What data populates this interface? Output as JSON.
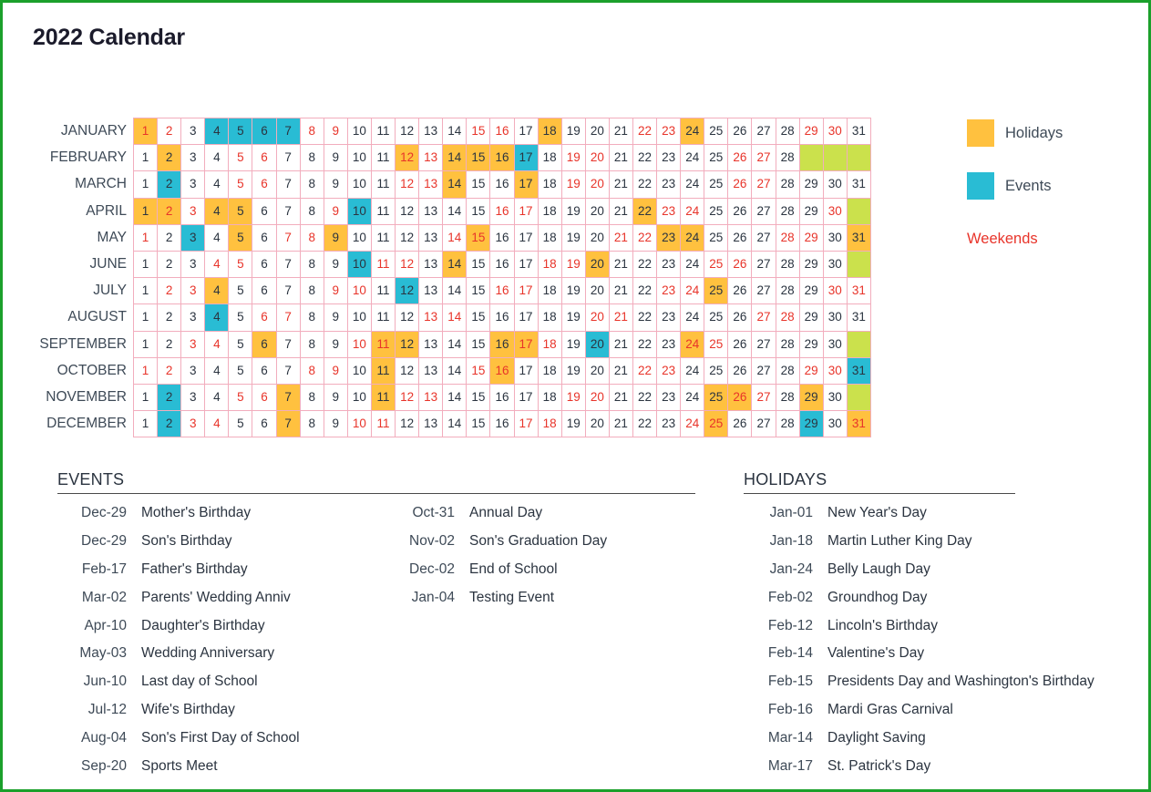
{
  "page": {
    "title": "2022 Calendar",
    "frame_color": "#1ba02b"
  },
  "colors": {
    "holiday": "#ffc13f",
    "event": "#29bcd4",
    "weekend_text": "#e8342a",
    "blank_day": "#cbe14c",
    "grid_border": "#f2adbd"
  },
  "legend": {
    "items": [
      {
        "label": "Holidays",
        "swatch": "#ffc13f",
        "icon": "holiday-swatch"
      },
      {
        "label": "Events",
        "swatch": "#29bcd4",
        "icon": "event-swatch"
      }
    ],
    "weekends_label": "Weekends"
  },
  "calendar": {
    "year": "2022",
    "months": [
      {
        "name": "JANUARY",
        "days": 31,
        "weekends": [
          1,
          2,
          8,
          9,
          15,
          16,
          22,
          23,
          29,
          30
        ],
        "holidays": [
          1,
          18,
          24
        ],
        "events": [
          4,
          5,
          6,
          7
        ]
      },
      {
        "name": "FEBRUARY",
        "days": 28,
        "weekends": [
          5,
          6,
          12,
          13,
          19,
          20,
          26,
          27
        ],
        "holidays": [
          2,
          12,
          14,
          15,
          16
        ],
        "events": [
          17
        ]
      },
      {
        "name": "MARCH",
        "days": 31,
        "weekends": [
          5,
          6,
          12,
          13,
          19,
          20,
          26,
          27
        ],
        "holidays": [
          14,
          17
        ],
        "events": [
          2
        ]
      },
      {
        "name": "APRIL",
        "days": 30,
        "weekends": [
          2,
          3,
          9,
          16,
          17,
          23,
          24,
          30
        ],
        "holidays": [
          1,
          2,
          4,
          5,
          22
        ],
        "events": [
          10
        ]
      },
      {
        "name": "MAY",
        "days": 31,
        "weekends": [
          1,
          7,
          8,
          14,
          15,
          21,
          22,
          28,
          29
        ],
        "holidays": [
          5,
          9,
          15,
          23,
          24,
          31
        ],
        "events": [
          3
        ]
      },
      {
        "name": "JUNE",
        "days": 30,
        "weekends": [
          4,
          5,
          11,
          12,
          18,
          19,
          25,
          26
        ],
        "holidays": [
          14,
          20
        ],
        "events": [
          10
        ]
      },
      {
        "name": "JULY",
        "days": 31,
        "weekends": [
          2,
          3,
          9,
          10,
          16,
          17,
          23,
          24,
          30,
          31
        ],
        "holidays": [
          4,
          25
        ],
        "events": [
          12
        ]
      },
      {
        "name": "AUGUST",
        "days": 31,
        "weekends": [
          6,
          7,
          13,
          14,
          20,
          21,
          27,
          28
        ],
        "holidays": [],
        "events": [
          4
        ]
      },
      {
        "name": "SEPTEMBER",
        "days": 30,
        "weekends": [
          3,
          4,
          10,
          11,
          17,
          18,
          24,
          25
        ],
        "holidays": [
          6,
          11,
          12,
          16,
          17,
          24
        ],
        "events": [
          20
        ]
      },
      {
        "name": "OCTOBER",
        "days": 31,
        "weekends": [
          1,
          2,
          8,
          9,
          15,
          16,
          22,
          23,
          29,
          30
        ],
        "holidays": [
          11,
          16
        ],
        "events": [
          31
        ]
      },
      {
        "name": "NOVEMBER",
        "days": 30,
        "weekends": [
          5,
          6,
          12,
          13,
          19,
          20,
          26,
          27
        ],
        "holidays": [
          7,
          11,
          25,
          26,
          29
        ],
        "events": [
          2
        ]
      },
      {
        "name": "DECEMBER",
        "days": 31,
        "weekends": [
          3,
          4,
          10,
          11,
          17,
          18,
          24,
          25,
          31
        ],
        "holidays": [
          7,
          25,
          31
        ],
        "events": [
          2,
          29
        ]
      }
    ],
    "max_days": 31
  },
  "events_section": {
    "heading": "EVENTS",
    "column_1": [
      {
        "date": "Dec-29",
        "name": "Mother's Birthday"
      },
      {
        "date": "Dec-29",
        "name": "Son's Birthday"
      },
      {
        "date": "Feb-17",
        "name": "Father's Birthday"
      },
      {
        "date": "Mar-02",
        "name": "Parents' Wedding Anniv"
      },
      {
        "date": "Apr-10",
        "name": "Daughter's Birthday"
      },
      {
        "date": "May-03",
        "name": "Wedding Anniversary"
      },
      {
        "date": "Jun-10",
        "name": "Last day of School"
      },
      {
        "date": "Jul-12",
        "name": "Wife's Birthday"
      },
      {
        "date": "Aug-04",
        "name": "Son's First Day of School"
      },
      {
        "date": "Sep-20",
        "name": "Sports Meet"
      }
    ],
    "column_2": [
      {
        "date": "Oct-31",
        "name": "Annual Day"
      },
      {
        "date": "Nov-02",
        "name": "Son's Graduation Day"
      },
      {
        "date": "Dec-02",
        "name": "End of School"
      },
      {
        "date": "Jan-04",
        "name": "Testing Event"
      }
    ]
  },
  "holidays_section": {
    "heading": "HOLIDAYS",
    "items": [
      {
        "date": "Jan-01",
        "name": "New Year's Day"
      },
      {
        "date": "Jan-18",
        "name": "Martin Luther King Day"
      },
      {
        "date": "Jan-24",
        "name": "Belly Laugh Day"
      },
      {
        "date": "Feb-02",
        "name": "Groundhog Day"
      },
      {
        "date": "Feb-12",
        "name": "Lincoln's Birthday"
      },
      {
        "date": "Feb-14",
        "name": "Valentine's Day"
      },
      {
        "date": "Feb-15",
        "name": "Presidents Day and Washington's Birthday"
      },
      {
        "date": "Feb-16",
        "name": "Mardi Gras Carnival"
      },
      {
        "date": "Mar-14",
        "name": "Daylight Saving"
      },
      {
        "date": "Mar-17",
        "name": "St. Patrick's Day"
      }
    ]
  }
}
